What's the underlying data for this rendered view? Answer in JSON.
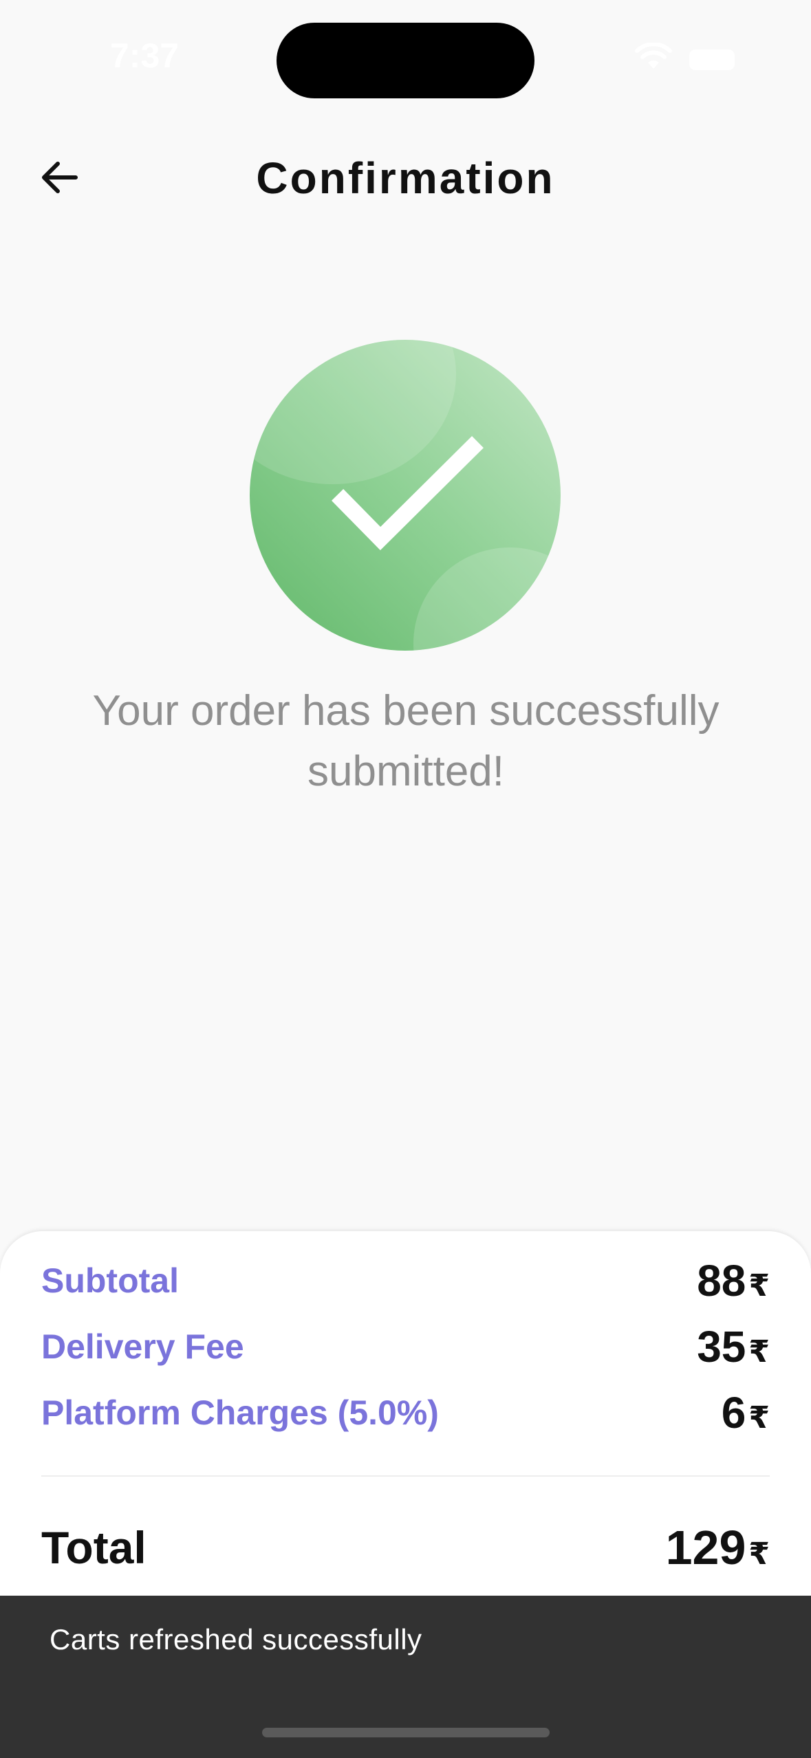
{
  "status_bar": {
    "time": "7:37"
  },
  "header": {
    "title": "Confirmation"
  },
  "confirmation": {
    "message": "Your order has been successfully submitted!"
  },
  "summary": {
    "currency_symbol": "₹",
    "rows": [
      {
        "label": "Subtotal",
        "amount": "88"
      },
      {
        "label": "Delivery Fee",
        "amount": "35"
      },
      {
        "label": "Platform Charges (5.0%)",
        "amount": "6"
      }
    ],
    "total": {
      "label": "Total",
      "amount": "129"
    }
  },
  "snackbar": {
    "message": "Carts refreshed successfully"
  },
  "colors": {
    "accent_label": "#7a73db",
    "success_green": "#8fd195",
    "snackbar_bg": "#323232"
  }
}
